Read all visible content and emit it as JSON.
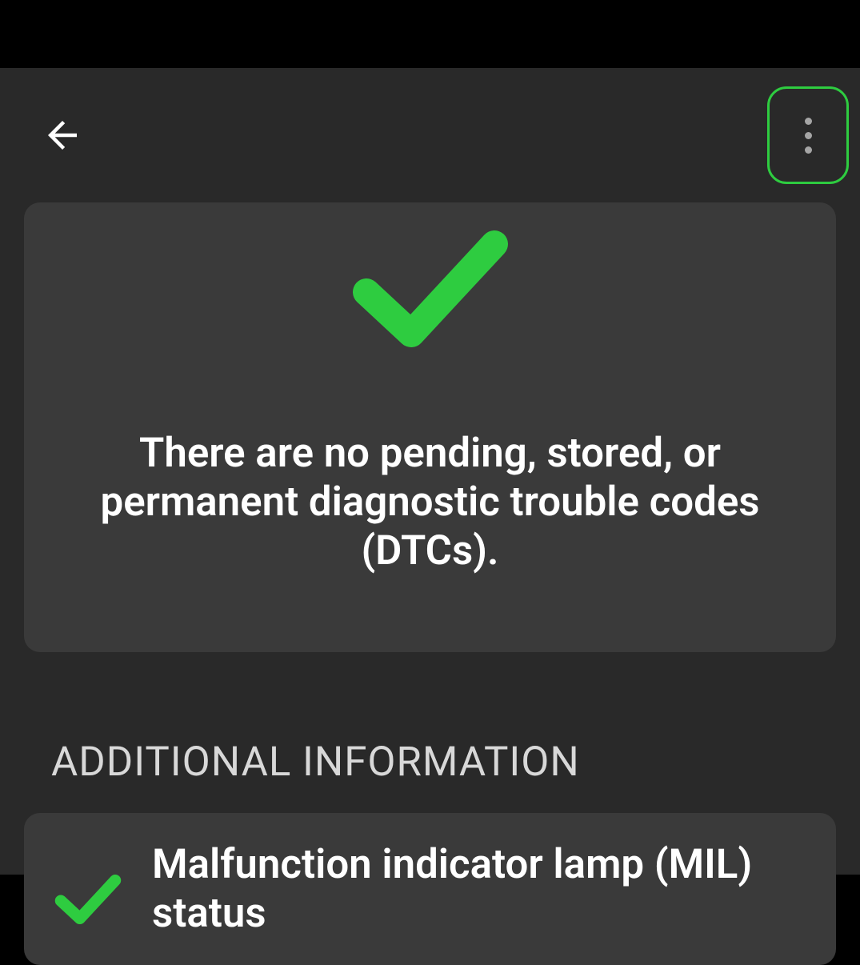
{
  "main": {
    "status_message": "There are no pending, stored, or permanent diagnostic trouble codes (DTCs)."
  },
  "sections": {
    "additional_info": {
      "heading": "ADDITIONAL INFORMATION",
      "items": [
        {
          "label": "Malfunction indicator lamp (MIL) status"
        }
      ]
    }
  },
  "colors": {
    "accent": "#2ecc40",
    "background": "#292929",
    "card": "#3a3a3a"
  }
}
